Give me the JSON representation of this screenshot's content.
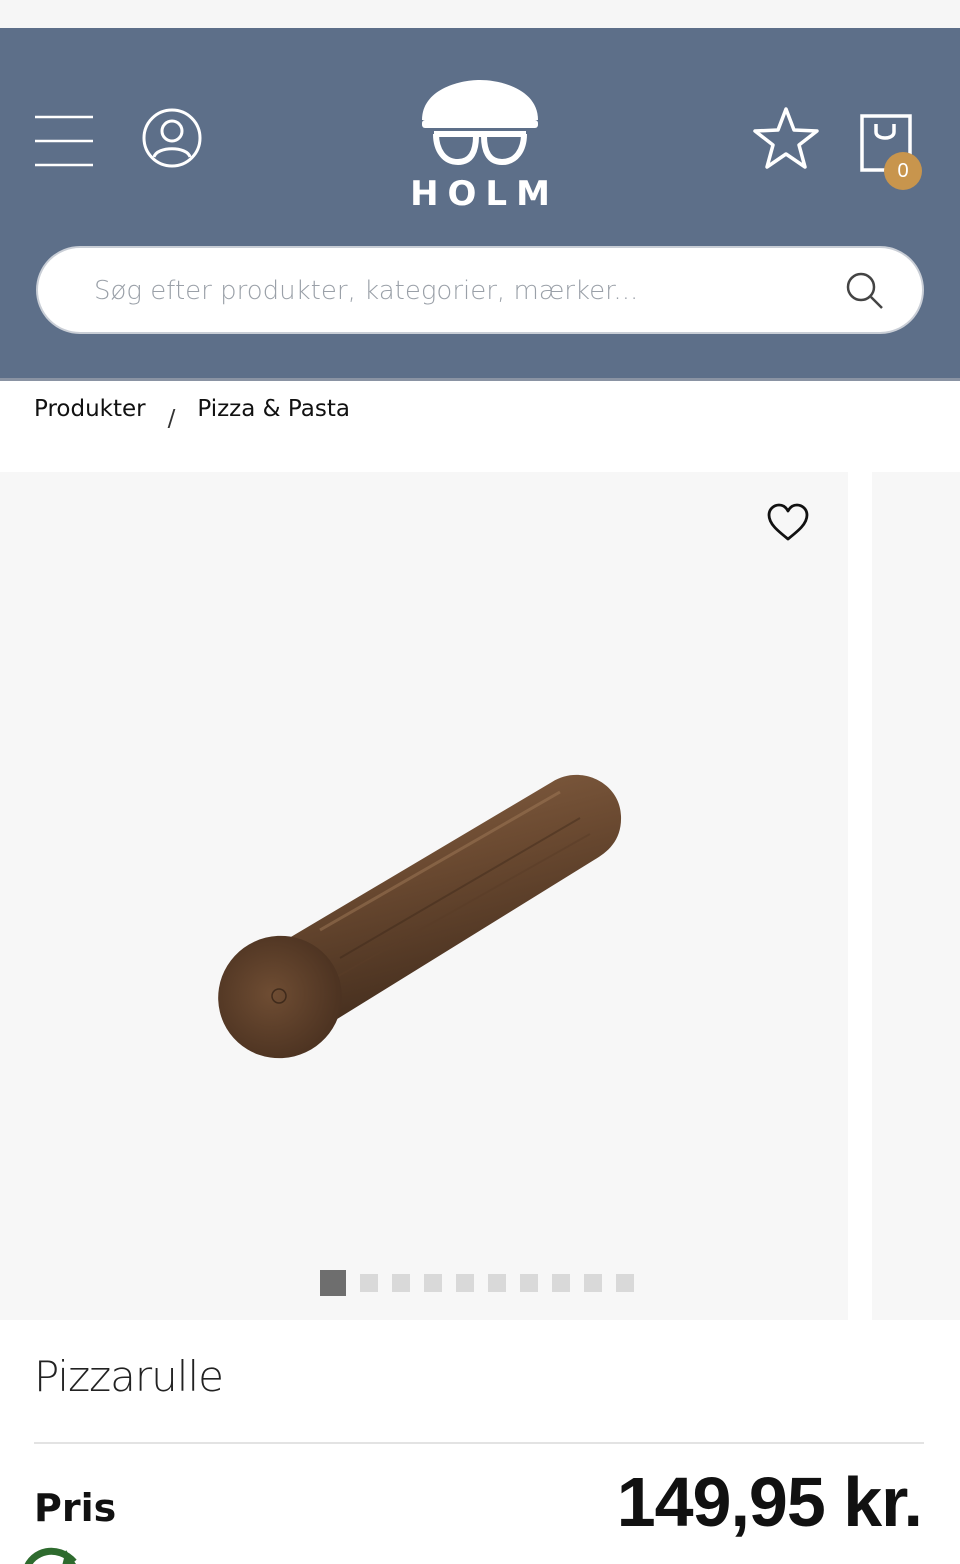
{
  "brand": {
    "name": "HOLM"
  },
  "header": {
    "search_placeholder": "Søg efter produkter, kategorier, mærker...",
    "cart_count": "0"
  },
  "breadcrumb": {
    "items": [
      "Produkter",
      "Pizza & Pasta"
    ],
    "separator": "/"
  },
  "gallery": {
    "slide_count": 10,
    "active_index": 0
  },
  "product": {
    "title": "Pizzarulle",
    "price_label": "Pris",
    "price": "149,95 kr."
  },
  "colors": {
    "header_bg": "#5d6f89",
    "cart_badge": "#c8954d",
    "gallery_bg": "#f7f7f7",
    "dot_active": "#6e6e6e",
    "dot_inactive": "#d9d9d9"
  },
  "icons": {
    "menu": "hamburger-menu-icon",
    "account": "user-account-icon",
    "wishlist": "star-icon",
    "cart": "shopping-bag-icon",
    "search": "search-icon",
    "favorite": "heart-icon",
    "eco": "recycle-icon"
  }
}
